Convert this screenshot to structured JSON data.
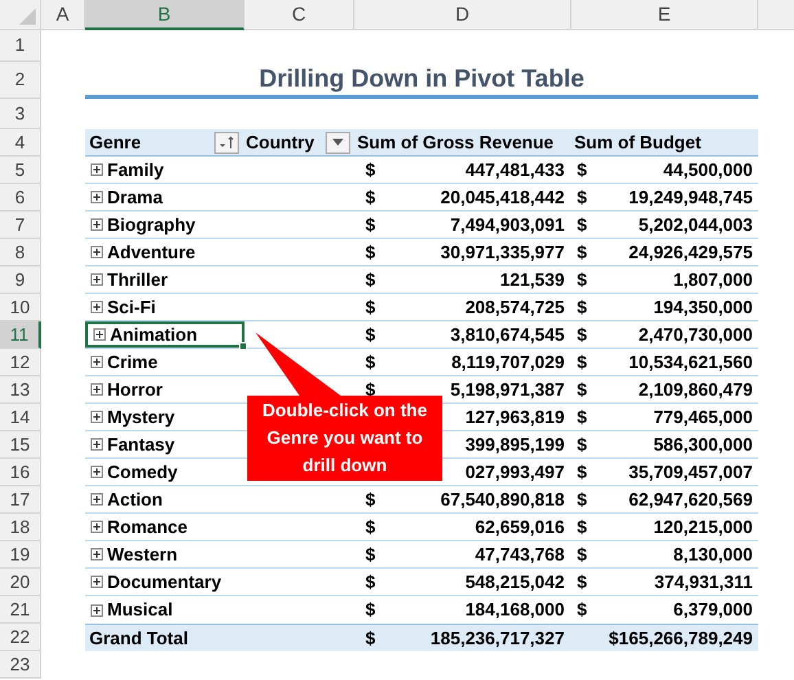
{
  "columns": [
    {
      "label": "A",
      "selected": false
    },
    {
      "label": "B",
      "selected": true
    },
    {
      "label": "C",
      "selected": false
    },
    {
      "label": "D",
      "selected": false
    },
    {
      "label": "E",
      "selected": false
    }
  ],
  "row_numbers": [
    {
      "label": "1",
      "selected": false
    },
    {
      "label": "2",
      "selected": false
    },
    {
      "label": "3",
      "selected": false
    },
    {
      "label": "4",
      "selected": false
    },
    {
      "label": "5",
      "selected": false
    },
    {
      "label": "6",
      "selected": false
    },
    {
      "label": "7",
      "selected": false
    },
    {
      "label": "8",
      "selected": false
    },
    {
      "label": "9",
      "selected": false
    },
    {
      "label": "10",
      "selected": false
    },
    {
      "label": "11",
      "selected": true
    },
    {
      "label": "12",
      "selected": false
    },
    {
      "label": "13",
      "selected": false
    },
    {
      "label": "14",
      "selected": false
    },
    {
      "label": "15",
      "selected": false
    },
    {
      "label": "16",
      "selected": false
    },
    {
      "label": "17",
      "selected": false
    },
    {
      "label": "18",
      "selected": false
    },
    {
      "label": "19",
      "selected": false
    },
    {
      "label": "20",
      "selected": false
    },
    {
      "label": "21",
      "selected": false
    },
    {
      "label": "22",
      "selected": false
    },
    {
      "label": "23",
      "selected": false
    }
  ],
  "title": "Drilling Down in Pivot Table",
  "pivot": {
    "headers": {
      "genre": "Genre",
      "country": "Country",
      "gross": "Sum of Gross Revenue",
      "budget": "Sum of Budget"
    },
    "rows": [
      {
        "genre": "Family",
        "d_sign": "$",
        "gross": "447,481,433",
        "e_sign": "$",
        "budget": "44,500,000",
        "selected": false
      },
      {
        "genre": "Drama",
        "d_sign": "$",
        "gross": "20,045,418,442",
        "e_sign": "$",
        "budget": "19,249,948,745",
        "selected": false
      },
      {
        "genre": "Biography",
        "d_sign": "$",
        "gross": "7,494,903,091",
        "e_sign": "$",
        "budget": "5,202,044,003",
        "selected": false
      },
      {
        "genre": "Adventure",
        "d_sign": "$",
        "gross": "30,971,335,977",
        "e_sign": "$",
        "budget": "24,926,429,575",
        "selected": false
      },
      {
        "genre": "Thriller",
        "d_sign": "$",
        "gross": "121,539",
        "e_sign": "$",
        "budget": "1,807,000",
        "selected": false
      },
      {
        "genre": "Sci-Fi",
        "d_sign": "$",
        "gross": "208,574,725",
        "e_sign": "$",
        "budget": "194,350,000",
        "selected": false
      },
      {
        "genre": "Animation",
        "d_sign": "$",
        "gross": "3,810,674,545",
        "e_sign": "$",
        "budget": "2,470,730,000",
        "selected": true
      },
      {
        "genre": "Crime",
        "d_sign": "$",
        "gross": "8,119,707,029",
        "e_sign": "$",
        "budget": "10,534,621,560",
        "selected": false
      },
      {
        "genre": "Horror",
        "d_sign": "$",
        "gross": "5,198,971,387",
        "e_sign": "$",
        "budget": "2,109,860,479",
        "selected": false
      },
      {
        "genre": "Mystery",
        "gross": "127,963,819",
        "e_sign": "$",
        "budget": "779,465,000",
        "selected": false
      },
      {
        "genre": "Fantasy",
        "gross": "399,895,199",
        "e_sign": "$",
        "budget": "586,300,000",
        "selected": false
      },
      {
        "genre": "Comedy",
        "gross": "027,993,497",
        "e_sign": "$",
        "budget": "35,709,457,007",
        "selected": false
      },
      {
        "genre": "Action",
        "d_sign": "$",
        "gross": "67,540,890,818",
        "e_sign": "$",
        "budget": "62,947,620,569",
        "selected": false
      },
      {
        "genre": "Romance",
        "d_sign": "$",
        "gross": "62,659,016",
        "e_sign": "$",
        "budget": "120,215,000",
        "selected": false
      },
      {
        "genre": "Western",
        "d_sign": "$",
        "gross": "47,743,768",
        "e_sign": "$",
        "budget": "8,130,000",
        "selected": false
      },
      {
        "genre": "Documentary",
        "d_sign": "$",
        "gross": "548,215,042",
        "e_sign": "$",
        "budget": "374,931,311",
        "selected": false
      },
      {
        "genre": "Musical",
        "d_sign": "$",
        "gross": "184,168,000",
        "e_sign": "$",
        "budget": "6,379,000",
        "selected": false
      }
    ],
    "grand_total": {
      "label": "Grand Total",
      "d_sign": "$",
      "gross": "185,236,717,327",
      "budget": "$165,266,789,249"
    }
  },
  "callout": "Double-click on the Genre you want to drill down"
}
